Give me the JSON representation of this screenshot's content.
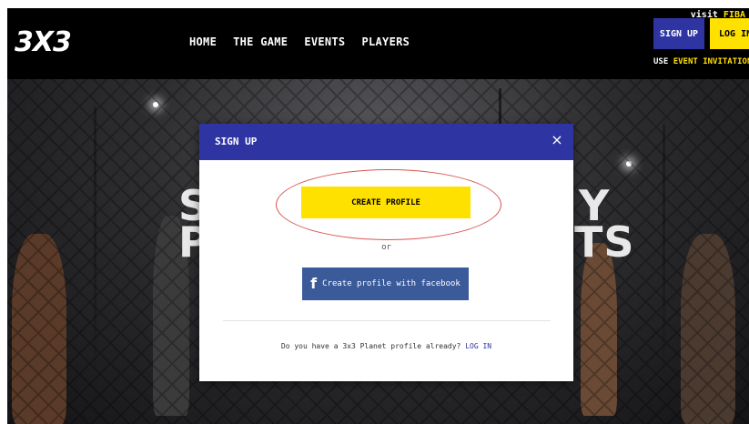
{
  "brand": {
    "logo": "3X3"
  },
  "nav": {
    "items": [
      "HOME",
      "THE GAME",
      "EVENTS",
      "PLAYERS"
    ]
  },
  "header": {
    "visit_prefix": "visit",
    "visit_link": "FIBA",
    "signup_label": "SIGN UP",
    "login_label": "LOG IN",
    "invite_prefix": "USE",
    "invite_accent": "EVENT INVITATION CODE"
  },
  "hero": {
    "line1_left": "ST",
    "line1_right": "Y",
    "line2_left": "PI",
    "line2_right": "TS"
  },
  "modal": {
    "title": "SIGN UP",
    "close_icon": "×",
    "create_profile_label": "CREATE PROFILE",
    "or_text": "or",
    "facebook_icon": "f",
    "facebook_label": "Create profile with facebook",
    "existing_text": "Do you have a 3x3 Planet profile already?",
    "login_link": "LOG IN"
  },
  "colors": {
    "brand_blue": "#2e35a3",
    "brand_yellow": "#ffe100",
    "facebook_blue": "#3b5a9a",
    "highlight": "#d9534f"
  }
}
